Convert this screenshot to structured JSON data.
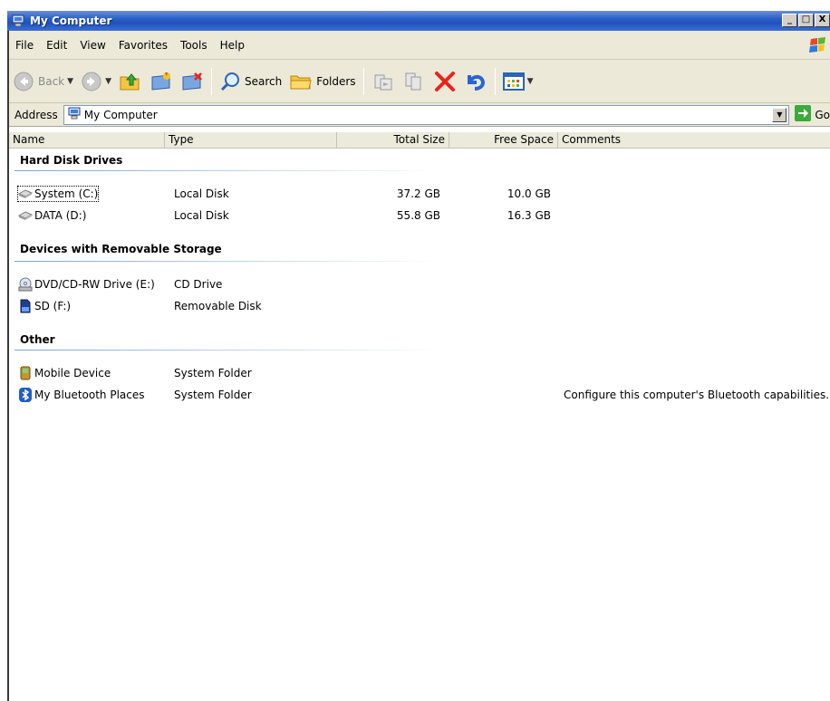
{
  "window": {
    "title": "My Computer",
    "controls": [
      "_",
      "□",
      "X"
    ]
  },
  "menu": [
    "File",
    "Edit",
    "View",
    "Favorites",
    "Tools",
    "Help"
  ],
  "menu_underline": [
    "F",
    "E",
    "V",
    "a",
    "T",
    "H"
  ],
  "toolbar": {
    "back": "Back",
    "search": "Search",
    "folders": "Folders"
  },
  "address": {
    "label": "Address",
    "value": "My Computer",
    "go": "Go"
  },
  "columns": {
    "name": "Name",
    "type": "Type",
    "total": "Total Size",
    "free": "Free Space",
    "comments": "Comments"
  },
  "groups": [
    {
      "title": "Hard Disk Drives",
      "items": [
        {
          "name": "System (C:)",
          "type": "Local Disk",
          "total": "37.2 GB",
          "free": "10.0 GB",
          "comment": "",
          "icon": "hard-disk-icon"
        },
        {
          "name": "DATA (D:)",
          "type": "Local Disk",
          "total": "55.8 GB",
          "free": "16.3 GB",
          "comment": "",
          "icon": "hard-disk-icon"
        }
      ]
    },
    {
      "title": "Devices with Removable Storage",
      "items": [
        {
          "name": "DVD/CD-RW Drive (E:)",
          "type": "CD Drive",
          "total": "",
          "free": "",
          "comment": "",
          "icon": "cd-drive-icon"
        },
        {
          "name": "SD (F:)",
          "type": "Removable Disk",
          "total": "",
          "free": "",
          "comment": "",
          "icon": "sd-card-icon"
        }
      ]
    },
    {
      "title": "Other",
      "items": [
        {
          "name": "Mobile Device",
          "type": "System Folder",
          "total": "",
          "free": "",
          "comment": "",
          "icon": "mobile-device-icon"
        },
        {
          "name": "My Bluetooth Places",
          "type": "System Folder",
          "total": "",
          "free": "",
          "comment": "Configure this computer's Bluetooth capabilities.",
          "icon": "bluetooth-icon"
        }
      ]
    }
  ],
  "colors": {
    "titlebar": "#2a5fc8",
    "chrome": "#ece9d8",
    "group_line": "#7d9fd2",
    "delete_red": "#e8231c"
  }
}
